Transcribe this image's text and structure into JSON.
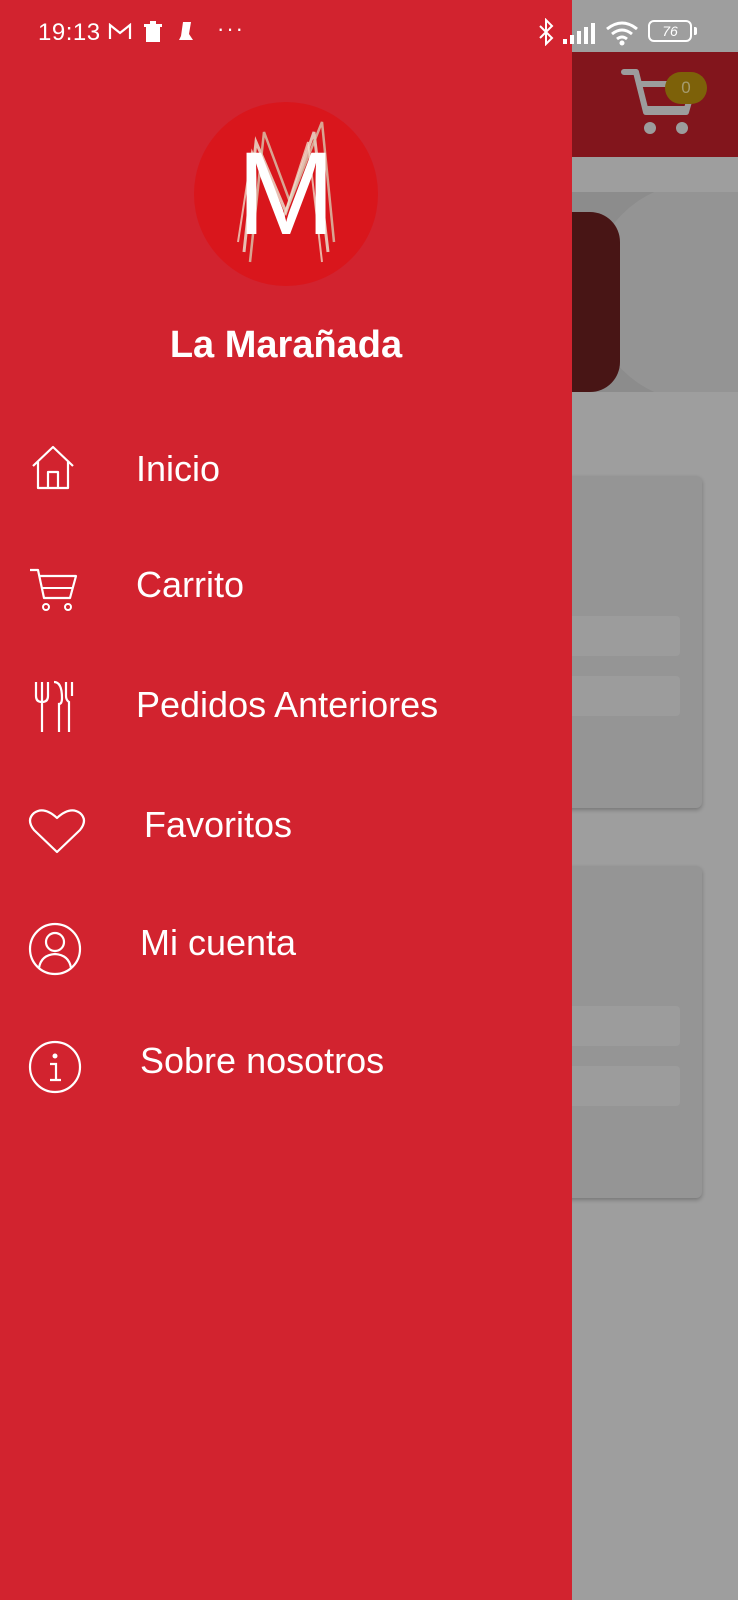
{
  "status_bar": {
    "time": "19:13",
    "battery": "76",
    "icons": [
      "gmail-icon",
      "trash-icon",
      "boot-icon",
      "more-icon",
      "bluetooth-icon",
      "signal-icon",
      "wifi-icon",
      "battery-icon"
    ]
  },
  "drawer": {
    "logo_letter": "M",
    "title": "La Marañada",
    "items": [
      {
        "label": "Inicio",
        "icon": "home-icon"
      },
      {
        "label": "Carrito",
        "icon": "cart-icon"
      },
      {
        "label": "Pedidos Anteriores",
        "icon": "cutlery-icon"
      },
      {
        "label": "Favoritos",
        "icon": "heart-icon"
      },
      {
        "label": "Mi cuenta",
        "icon": "user-icon"
      },
      {
        "label": "Sobre nosotros",
        "icon": "info-icon"
      }
    ]
  },
  "background_app": {
    "cart_count": "0"
  },
  "colors": {
    "drawer": "#d2232f",
    "header": "#c0202a",
    "badge": "#b8900e"
  }
}
